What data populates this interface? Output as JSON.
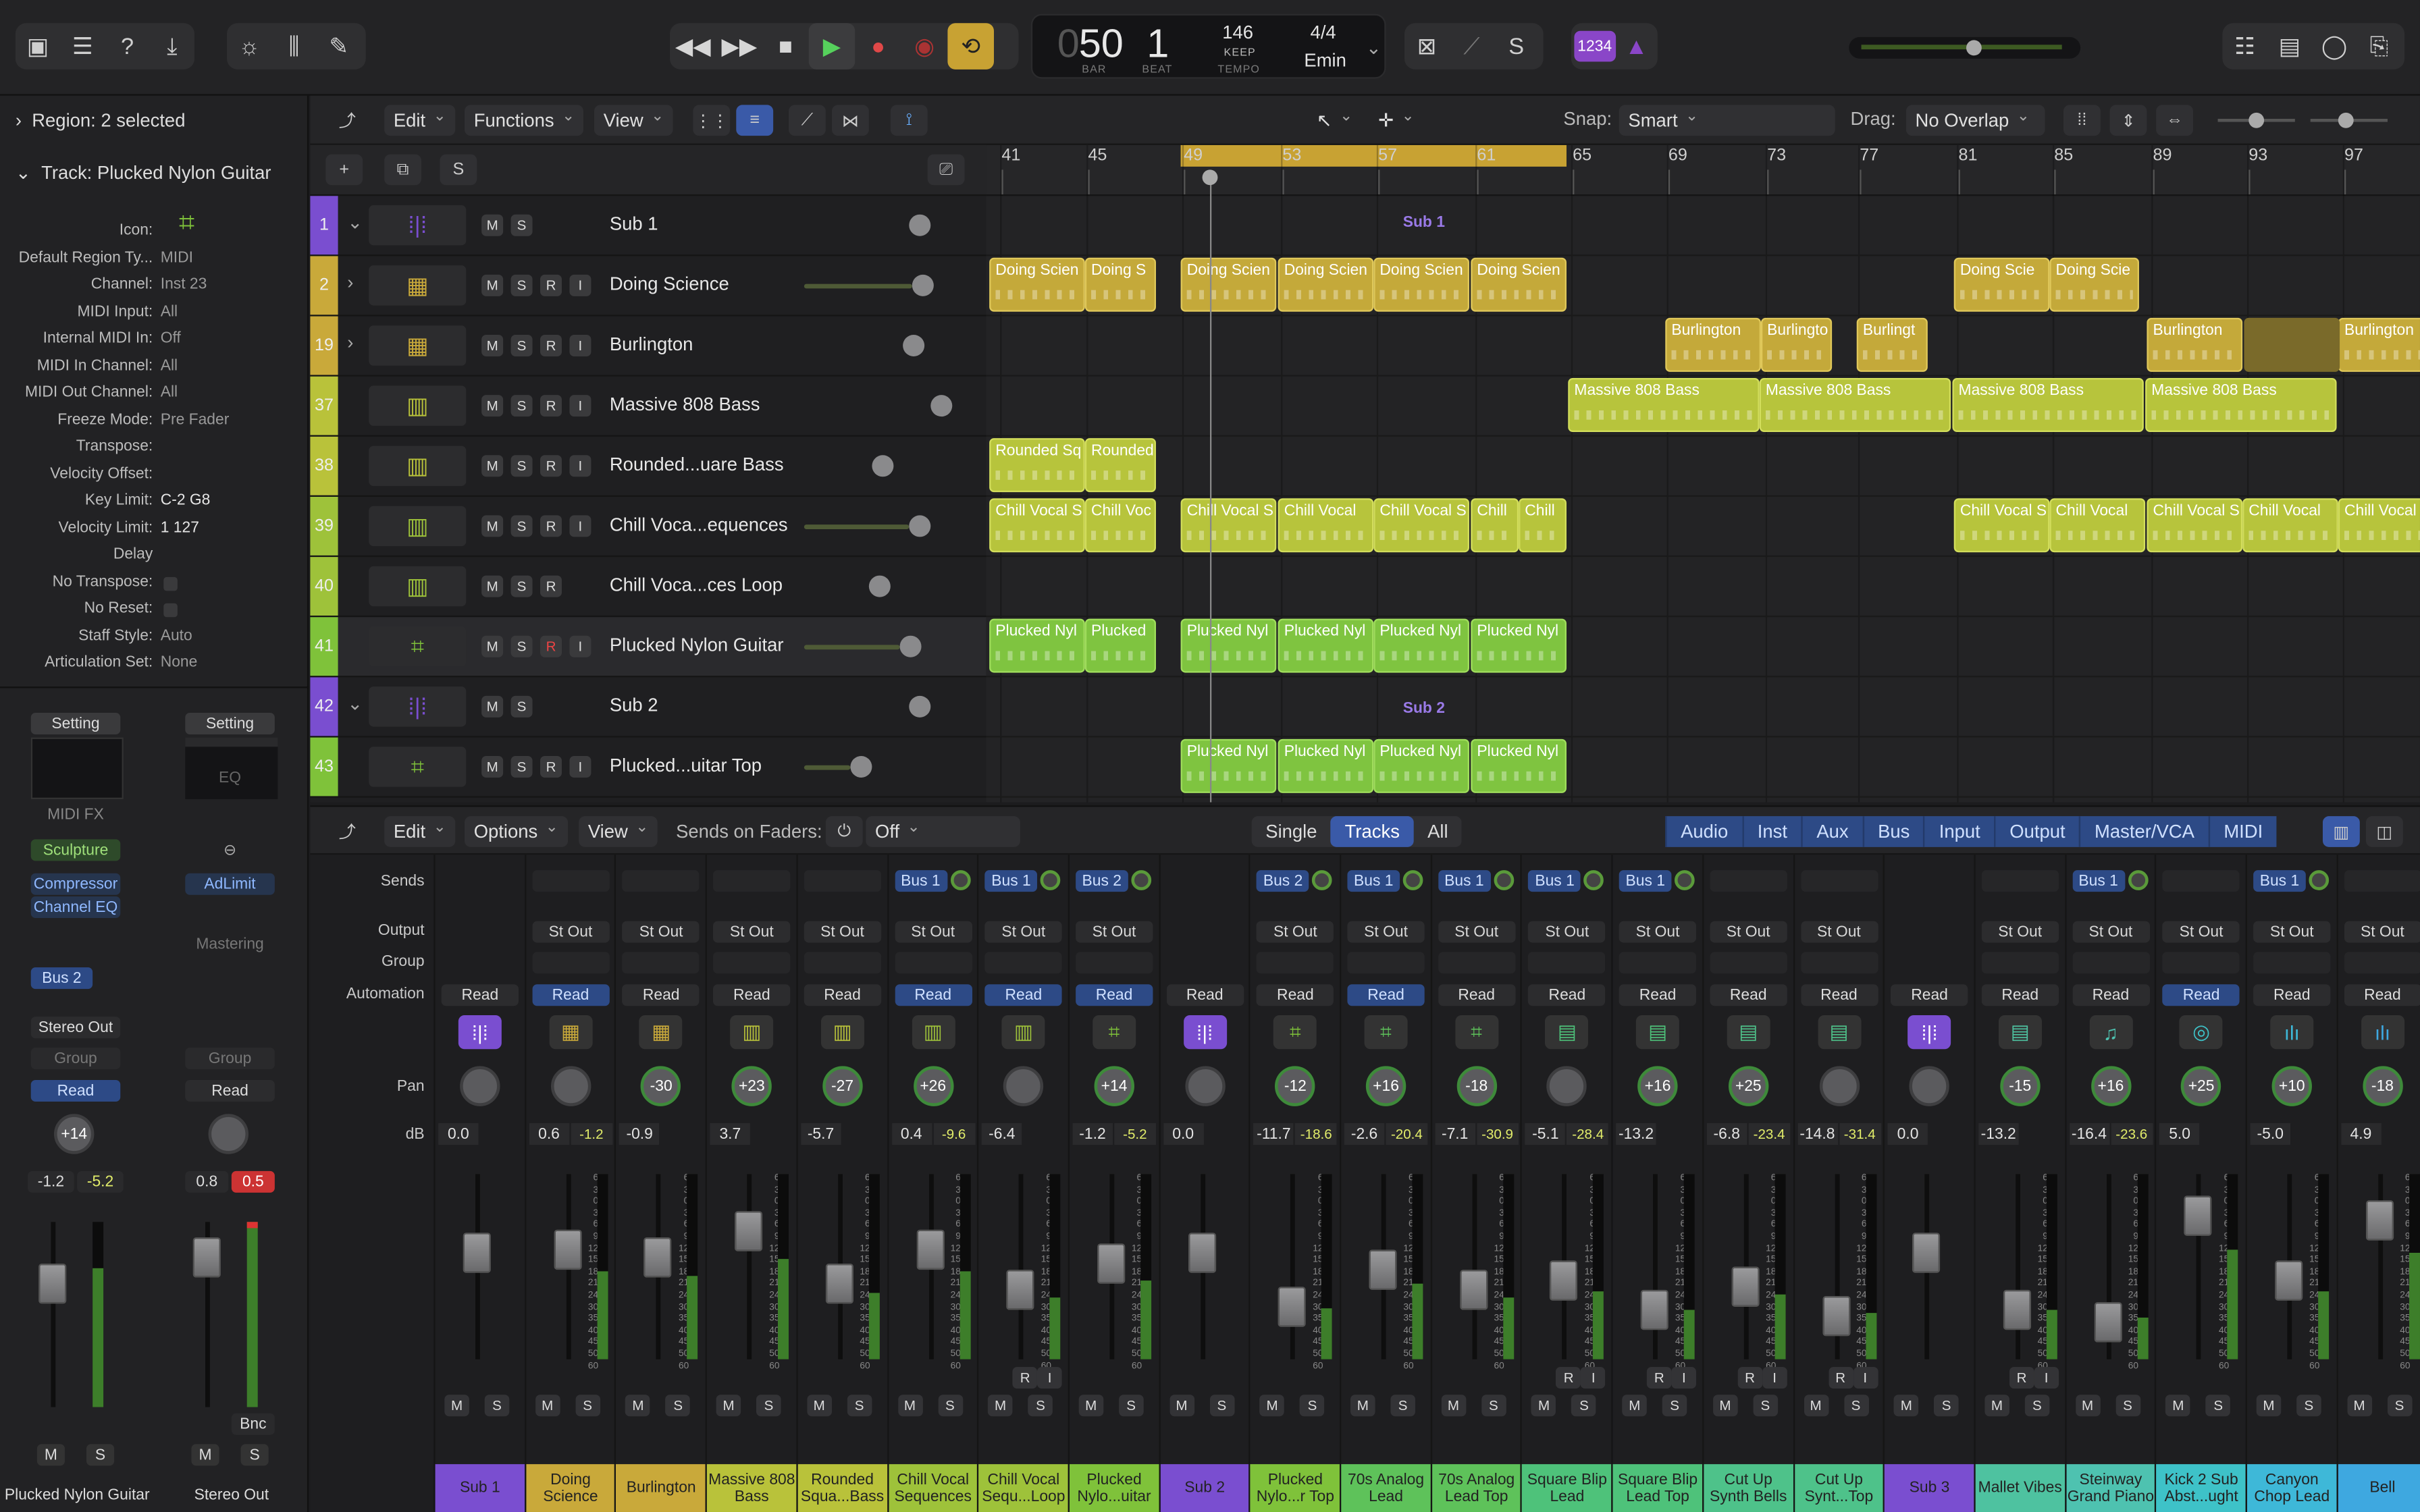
{
  "control_bar": {
    "lcd": {
      "bar": "50",
      "bar_label": "BAR",
      "beat": "1",
      "beat_label": "BEAT",
      "tempo": "146",
      "tempo_mode": "KEEP",
      "tempo_label": "TEMPO",
      "signature": "4/4",
      "key": "Emin"
    },
    "counter": "1234"
  },
  "inspector": {
    "region": "Region: 2 selected",
    "track": "Track: Plucked Nylon Guitar",
    "params": [
      {
        "label": "Icon:",
        "value": ""
      },
      {
        "label": "Default Region Ty...",
        "value": "MIDI"
      },
      {
        "label": "Channel:",
        "value": "Inst 23"
      },
      {
        "label": "MIDI Input:",
        "value": "All"
      },
      {
        "label": "Internal MIDI In:",
        "value": "Off"
      },
      {
        "label": "MIDI In Channel:",
        "value": "All"
      },
      {
        "label": "MIDI Out Channel:",
        "value": "All"
      },
      {
        "label": "Freeze Mode:",
        "value": "Pre Fader"
      },
      {
        "label": "Transpose:",
        "value": ""
      },
      {
        "label": "Velocity Offset:",
        "value": ""
      },
      {
        "label": "Key Limit:",
        "value": "C-2  G8"
      },
      {
        "label": "Velocity Limit:",
        "value": "1  127"
      },
      {
        "label": "Delay",
        "value": ""
      },
      {
        "label": "No Transpose:",
        "value": ""
      },
      {
        "label": "No Reset:",
        "value": ""
      },
      {
        "label": "Staff Style:",
        "value": "Auto"
      },
      {
        "label": "Articulation Set:",
        "value": "None"
      }
    ],
    "strip1": {
      "setting": "Setting",
      "midi_fx": "MIDI FX",
      "plugin1": "Sculpture",
      "plugin2": "Compressor",
      "plugin3": "Channel EQ",
      "send": "Bus 2",
      "output": "Stereo Out",
      "group": "Group",
      "automation": "Read",
      "pan": "+14",
      "db1": "-1.2",
      "db2": "-5.2",
      "name": "Plucked Nylon Guitar"
    },
    "strip2": {
      "setting": "Setting",
      "eq": "EQ",
      "plugin1": "AdLimit",
      "mastering": "Mastering",
      "group": "Group",
      "automation": "Read",
      "db1": "0.8",
      "db2": "0.5",
      "bnc": "Bnc",
      "name": "Stereo Out"
    }
  },
  "tracks_toolbar": {
    "edit": "Edit",
    "functions": "Functions",
    "view": "View",
    "snap_label": "Snap:",
    "snap": "Smart",
    "drag_label": "Drag:",
    "drag": "No Overlap"
  },
  "ruler": [
    "41",
    "45",
    "49",
    "53",
    "57",
    "61",
    "65",
    "69",
    "73",
    "77",
    "81",
    "85",
    "89",
    "93",
    "97"
  ],
  "tracks": [
    {
      "num": "1",
      "name": "Sub 1",
      "color": "#7a4ed0",
      "icon": "stack",
      "folder": true
    },
    {
      "num": "2",
      "name": "Doing Science",
      "color": "#c9a93a",
      "icon": "drum",
      "folder": true
    },
    {
      "num": "19",
      "name": "Burlington",
      "color": "#c9a93a",
      "icon": "drum",
      "folder": true
    },
    {
      "num": "37",
      "name": "Massive 808 Bass",
      "color": "#b9c23a",
      "icon": "keys"
    },
    {
      "num": "38",
      "name": "Rounded...uare Bass",
      "color": "#b9c23a",
      "icon": "keys"
    },
    {
      "num": "39",
      "name": "Chill Voca...equences",
      "color": "#9ec23a",
      "icon": "keys"
    },
    {
      "num": "40",
      "name": "Chill Voca...ces Loop",
      "color": "#9ec23a",
      "icon": "keys"
    },
    {
      "num": "41",
      "name": "Plucked Nylon Guitar",
      "color": "#7fc23a",
      "icon": "guitar"
    },
    {
      "num": "42",
      "name": "Sub 2",
      "color": "#7a4ed0",
      "icon": "stack",
      "folder": true
    },
    {
      "num": "43",
      "name": "Plucked...uitar Top",
      "color": "#7fc23a",
      "icon": "guitar"
    }
  ],
  "regions": {
    "sub1": "Sub 1",
    "sub2": "Sub 2",
    "doing": "Doing Scien",
    "doing2": "Doing S",
    "doing3": "Doing Scie",
    "burl": "Burlington",
    "burl2": "Burlingto",
    "burl3": "Burlingt",
    "massive": "Massive 808 Bass",
    "rounded": "Rounded Sq",
    "rounded2": "Rounded",
    "chill": "Chill Vocal S",
    "chill2": "Chill Voc",
    "chill3": "Chill Vocal",
    "chill4": "Chill",
    "pluck": "Plucked Nyl",
    "pluck2": "Plucked"
  },
  "mixer_toolbar": {
    "edit": "Edit",
    "options": "Options",
    "view": "View",
    "sends_label": "Sends on Faders:",
    "sends": "Off",
    "tabs": [
      "Single",
      "Tracks",
      "All"
    ],
    "filters": [
      "Audio",
      "Inst",
      "Aux",
      "Bus",
      "Input",
      "Output",
      "Master/VCA",
      "MIDI"
    ]
  },
  "mixer_labels": {
    "sends": "Sends",
    "output": "Output",
    "group": "Group",
    "automation": "Automation",
    "pan": "Pan",
    "db": "dB"
  },
  "strips": [
    {
      "name": "Sub 1",
      "color": "#7a4ed0",
      "icon": "stack",
      "send": "",
      "out": "",
      "auto": "Read",
      "autoOn": false,
      "pan": "",
      "db": "0.0",
      "db2": "",
      "fader": 0.6
    },
    {
      "name": "Doing Science",
      "color": "#c9a93a",
      "icon": "drum",
      "send": "",
      "out": "St Out",
      "auto": "Read",
      "autoOn": true,
      "pan": "",
      "db": "0.6",
      "db2": "-1.2",
      "fader": 0.62
    },
    {
      "name": "Burlington",
      "color": "#c9a93a",
      "icon": "drum",
      "send": "",
      "out": "St Out",
      "auto": "Read",
      "autoOn": false,
      "pan": "-30",
      "db": "-0.9",
      "db2": "",
      "fader": 0.56
    },
    {
      "name": "Massive 808 Bass",
      "color": "#b9c23a",
      "icon": "keys",
      "send": "",
      "out": "St Out",
      "auto": "Read",
      "autoOn": false,
      "pan": "+23",
      "db": "3.7",
      "db2": "",
      "fader": 0.75
    },
    {
      "name": "Rounded Squa...Bass",
      "color": "#b9c23a",
      "icon": "keys",
      "send": "",
      "out": "St Out",
      "auto": "Read",
      "autoOn": false,
      "pan": "-27",
      "db": "-5.7",
      "db2": "",
      "fader": 0.38
    },
    {
      "name": "Chill Vocal Sequences",
      "color": "#9ec23a",
      "icon": "keys",
      "send": "Bus 1",
      "out": "St Out",
      "auto": "Read",
      "autoOn": true,
      "pan": "+26",
      "db": "0.4",
      "db2": "-9.6",
      "fader": 0.62
    },
    {
      "name": "Chill Vocal Sequ...Loop",
      "color": "#9ec23a",
      "icon": "keys",
      "send": "Bus 1",
      "out": "St Out",
      "auto": "Read",
      "autoOn": true,
      "pan": "",
      "db": "-6.4",
      "db2": "",
      "fader": 0.34
    },
    {
      "name": "Plucked Nylo...uitar",
      "color": "#7fc23a",
      "icon": "guitar",
      "send": "Bus 2",
      "out": "St Out",
      "auto": "Read",
      "autoOn": true,
      "pan": "+14",
      "db": "-1.2",
      "db2": "-5.2",
      "fader": 0.52
    },
    {
      "name": "Sub 2",
      "color": "#7a4ed0",
      "icon": "stack",
      "send": "",
      "out": "",
      "auto": "Read",
      "autoOn": false,
      "pan": "",
      "db": "0.0",
      "db2": "",
      "fader": 0.6
    },
    {
      "name": "Plucked Nylo...r Top",
      "color": "#7fc23a",
      "icon": "guitar",
      "send": "Bus 2",
      "out": "St Out",
      "auto": "Read",
      "autoOn": false,
      "pan": "-12",
      "db": "-11.7",
      "db2": "-18.6",
      "fader": 0.22
    },
    {
      "name": "70s Analog Lead",
      "color": "#5ec25a",
      "icon": "guitar",
      "send": "Bus 1",
      "out": "St Out",
      "auto": "Read",
      "autoOn": true,
      "pan": "+16",
      "db": "-2.6",
      "db2": "-20.4",
      "fader": 0.48
    },
    {
      "name": "70s Analog Lead Top",
      "color": "#5ec25a",
      "icon": "guitar",
      "send": "Bus 1",
      "out": "St Out",
      "auto": "Read",
      "autoOn": false,
      "pan": "-18",
      "db": "-7.1",
      "db2": "-30.9",
      "fader": 0.34
    },
    {
      "name": "Square Blip Lead",
      "color": "#4ec27a",
      "icon": "synth",
      "send": "Bus 1",
      "out": "St Out",
      "auto": "Read",
      "autoOn": false,
      "pan": "",
      "db": "-5.1",
      "db2": "-28.4",
      "fader": 0.4
    },
    {
      "name": "Square Blip Lead Top",
      "color": "#4ec27a",
      "icon": "synth",
      "send": "Bus 1",
      "out": "St Out",
      "auto": "Read",
      "autoOn": false,
      "pan": "+16",
      "db": "-13.2",
      "db2": "",
      "fader": 0.2
    },
    {
      "name": "Cut Up Synth Bells",
      "color": "#4ec28a",
      "icon": "synth",
      "send": "",
      "out": "St Out",
      "auto": "Read",
      "autoOn": false,
      "pan": "+25",
      "db": "-6.8",
      "db2": "-23.4",
      "fader": 0.36
    },
    {
      "name": "Cut Up Synt...Top",
      "color": "#4ec28a",
      "icon": "synth",
      "send": "",
      "out": "St Out",
      "auto": "Read",
      "autoOn": false,
      "pan": "",
      "db": "-14.8",
      "db2": "-31.4",
      "fader": 0.16
    },
    {
      "name": "Sub 3",
      "color": "#7a4ed0",
      "icon": "stack",
      "send": "",
      "out": "",
      "auto": "Read",
      "autoOn": false,
      "pan": "",
      "db": "0.0",
      "db2": "",
      "fader": 0.6
    },
    {
      "name": "Mallet Vibes",
      "color": "#4ec2a0",
      "icon": "synth",
      "send": "",
      "out": "St Out",
      "auto": "Read",
      "autoOn": false,
      "pan": "-15",
      "db": "-13.2",
      "db2": "",
      "fader": 0.2
    },
    {
      "name": "Steinway Grand Piano",
      "color": "#4ec2b0",
      "icon": "piano",
      "send": "Bus 1",
      "out": "St Out",
      "auto": "Read",
      "autoOn": false,
      "pan": "+16",
      "db": "-16.4",
      "db2": "-23.6",
      "fader": 0.12
    },
    {
      "name": "Kick 2 Sub Abst...ught",
      "color": "#3ec2c8",
      "icon": "drum2",
      "send": "",
      "out": "St Out",
      "auto": "Read",
      "autoOn": true,
      "pan": "+25",
      "db": "5.0",
      "db2": "",
      "fader": 0.85
    },
    {
      "name": "Canyon Chop Lead",
      "color": "#3eb8d8",
      "icon": "wave",
      "send": "Bus 1",
      "out": "St Out",
      "auto": "Read",
      "autoOn": false,
      "pan": "+10",
      "db": "-5.0",
      "db2": "",
      "fader": 0.4
    },
    {
      "name": "Bell",
      "color": "#3ea8e0",
      "icon": "wave",
      "send": "",
      "out": "St Out",
      "auto": "Read",
      "autoOn": false,
      "pan": "-18",
      "db": "4.9",
      "db2": "",
      "fader": 0.82
    }
  ]
}
